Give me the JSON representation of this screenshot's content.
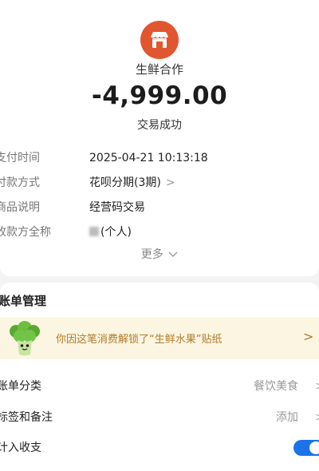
{
  "merchant": {
    "name": "生鲜合作",
    "icon": "store-icon",
    "icon_color": "#e2562f"
  },
  "transaction": {
    "amount": "-4,999.00",
    "status": "交易成功"
  },
  "details": [
    {
      "label": "支付时间",
      "value": "2025-04-21 10:13:18"
    },
    {
      "label": "付款方式",
      "value": "花呗分期(3期)",
      "chevron": ">"
    },
    {
      "label": "商品说明",
      "value": "经营码交易"
    },
    {
      "label": "收款方全称",
      "value": "(个人)"
    }
  ],
  "more_label": "更多",
  "bill_management": {
    "title": "账单管理",
    "promo": {
      "text": "你因这笔消费解锁了“生鲜水果”贴纸",
      "arrow": ">",
      "mascot": "broccoli-icon"
    },
    "rows": [
      {
        "label": "账单分类",
        "value": "餐饮美食",
        "chevron": ">"
      },
      {
        "label": "标签和备注",
        "value": "添加",
        "chevron": ">"
      },
      {
        "label": "计入收支",
        "toggle_on": true
      }
    ]
  },
  "colors": {
    "accent": "#1a73e8",
    "promo_bg": "#fbf5e2",
    "promo_text": "#b27c2a"
  }
}
